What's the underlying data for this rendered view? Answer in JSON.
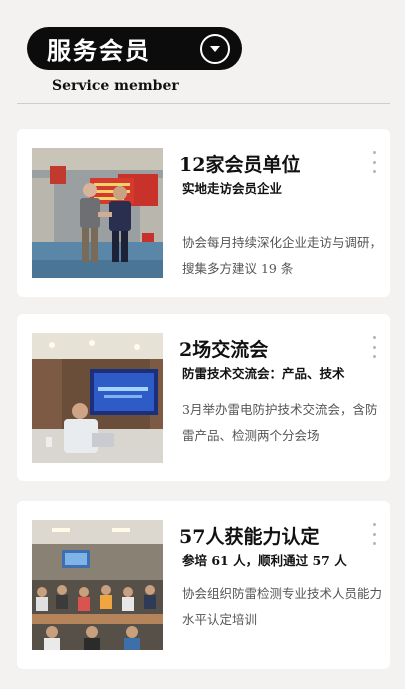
{
  "header": {
    "title": "服务会员",
    "subtitle": "Service member",
    "toggle_icon": "chevron-down-icon"
  },
  "cards": [
    {
      "title": "12家会员单位",
      "subtitle": "实地走访会员企业",
      "desc": "协会每月持续深化企业走访与调研，搜集多方建议 19 条",
      "image": "photo of two men shaking hands in front of a red banner"
    },
    {
      "title": "2场交流会",
      "subtitle": "防雷技术交流会：产品、技术",
      "desc": "3月举办雷电防护技术交流会，含防雷产品、检测两个分会场",
      "image": "photo of a presenter at a meeting with a projection screen"
    },
    {
      "title": "57人获能力认定",
      "subtitle": "参培 61 人，顺利通过 57 人",
      "desc": "协会组织防雷检测专业技术人员能力水平认定培训",
      "image": "photo of a training classroom with many attendees"
    }
  ],
  "colors": {
    "pill_bg": "#0c0c0c",
    "card_bg": "#ffffff",
    "page_bg": "#f3f2f0"
  }
}
